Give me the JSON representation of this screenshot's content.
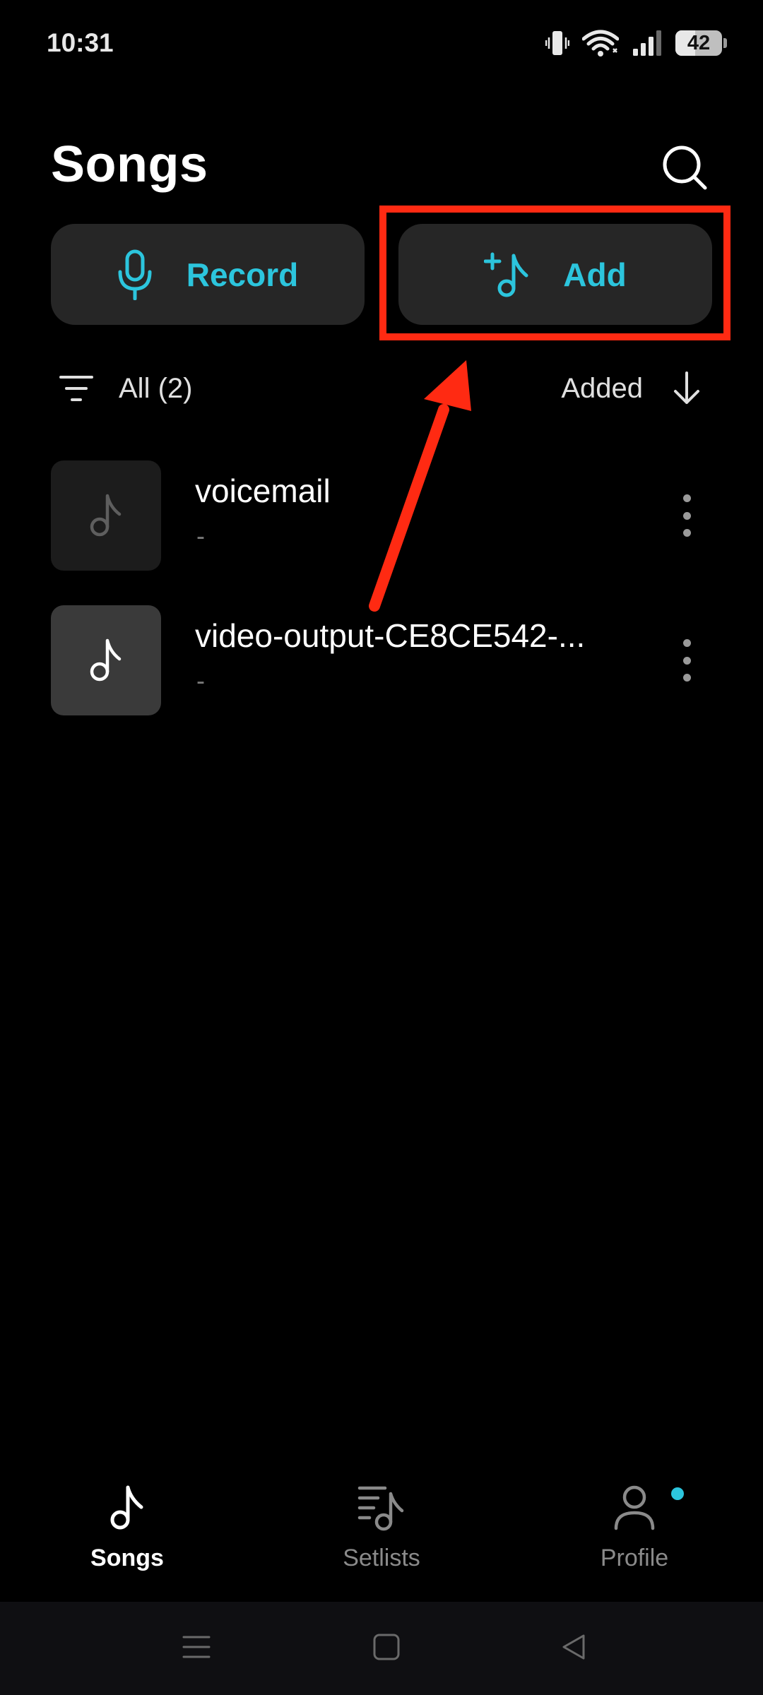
{
  "status_bar": {
    "time": "10:31",
    "battery_level": "42",
    "icons": [
      "vibrate-icon",
      "wifi-icon",
      "signal-icon",
      "battery-icon"
    ]
  },
  "header": {
    "title": "Songs",
    "search_icon": "search-icon"
  },
  "actions": {
    "record_label": "Record",
    "record_icon": "microphone-icon",
    "add_label": "Add",
    "add_icon": "add-music-icon",
    "accent_color": "#2cc5dd"
  },
  "filter": {
    "label": "All (2)",
    "sort_label": "Added",
    "filter_icon": "filter-icon",
    "sort_icon": "arrow-down-icon"
  },
  "songs": [
    {
      "title": "voicemail",
      "subtitle": "-"
    },
    {
      "title": "video-output-CE8CE542-...",
      "subtitle": "-"
    }
  ],
  "bottom_nav": {
    "items": [
      {
        "label": "Songs",
        "icon": "music-note-icon",
        "active": true
      },
      {
        "label": "Setlists",
        "icon": "setlist-icon",
        "active": false
      },
      {
        "label": "Profile",
        "icon": "profile-icon",
        "active": false
      }
    ]
  },
  "annotation": {
    "color": "#ff2a12",
    "target": "add-button"
  },
  "system_nav": {
    "icons": [
      "menu-icon",
      "home-icon",
      "back-icon"
    ]
  }
}
